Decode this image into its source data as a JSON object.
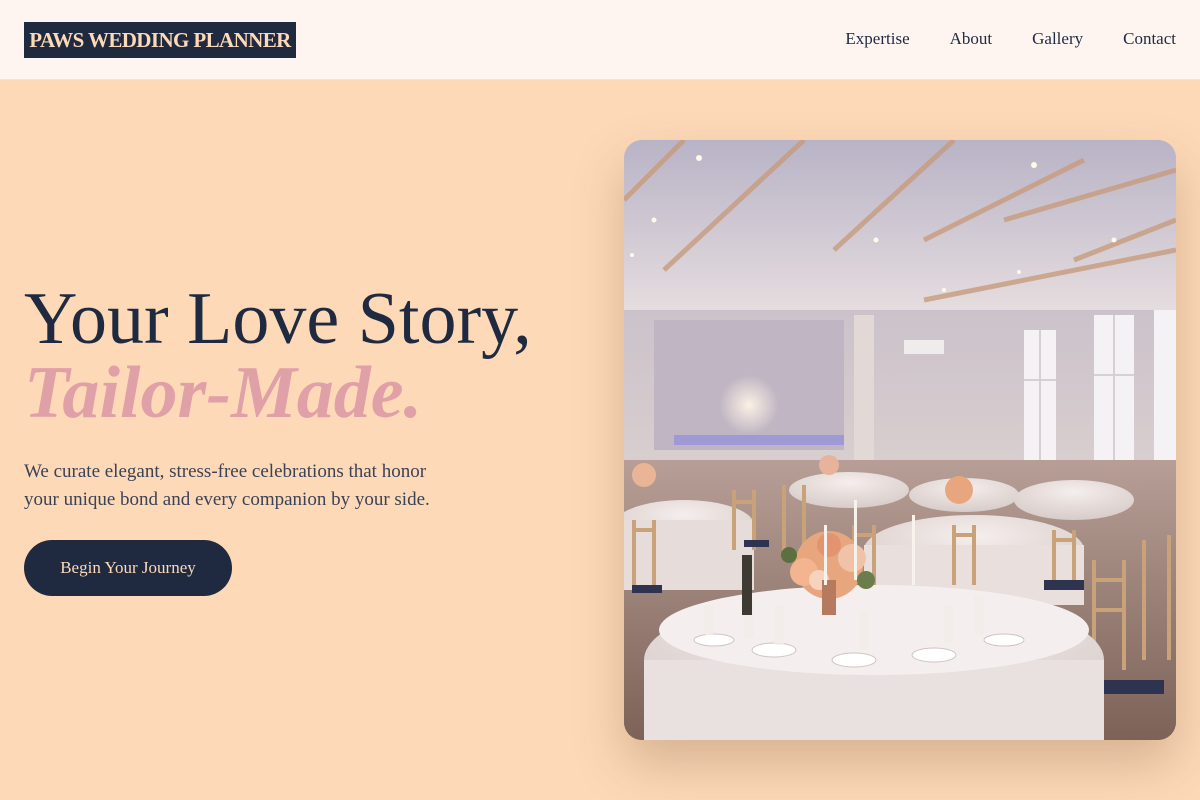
{
  "header": {
    "logo": "PAWS WEDDING PLANNER",
    "nav": [
      "Expertise",
      "About",
      "Gallery",
      "Contact"
    ]
  },
  "hero": {
    "headline_line1": "Your Love Story,",
    "headline_line2": "Tailor-Made.",
    "subtext": "We curate elegant, stress-free celebrations that honor your unique bond and every companion by your side.",
    "cta_label": "Begin Your Journey",
    "image_subject": "wedding reception banquet hall with round tables, floral centerpieces and chiavari chairs"
  },
  "colors": {
    "page_bg": "#fdd9b7",
    "header_bg": "#fff5f0",
    "navy": "#1f2a40",
    "accent_pink": "#e0a0a7"
  }
}
